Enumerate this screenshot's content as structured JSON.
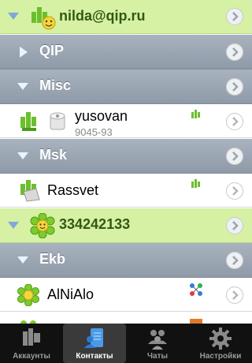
{
  "accounts": [
    {
      "name": "nilda@qip.ru"
    },
    {
      "name": "334242133"
    }
  ],
  "groups": [
    {
      "name": "QIP"
    },
    {
      "name": "Misc"
    },
    {
      "name": "Msk"
    },
    {
      "name": "Ekb"
    }
  ],
  "contacts": [
    {
      "name": "yusovan",
      "status": "9045-93"
    },
    {
      "name": "Rassvet"
    },
    {
      "name": "AlNiAlo"
    }
  ],
  "tabs": [
    {
      "label": "Аккаунты",
      "icon": "qip-logo-icon"
    },
    {
      "label": "Контакты",
      "icon": "contacts-icon",
      "active": true
    },
    {
      "label": "Чаты",
      "icon": "chats-icon"
    },
    {
      "label": "Настройки",
      "icon": "gear-icon"
    }
  ],
  "colors": {
    "account_bg": "#d6f0a4",
    "group_bg": "#9aa4b1",
    "tabbar_bg": "#111111"
  }
}
